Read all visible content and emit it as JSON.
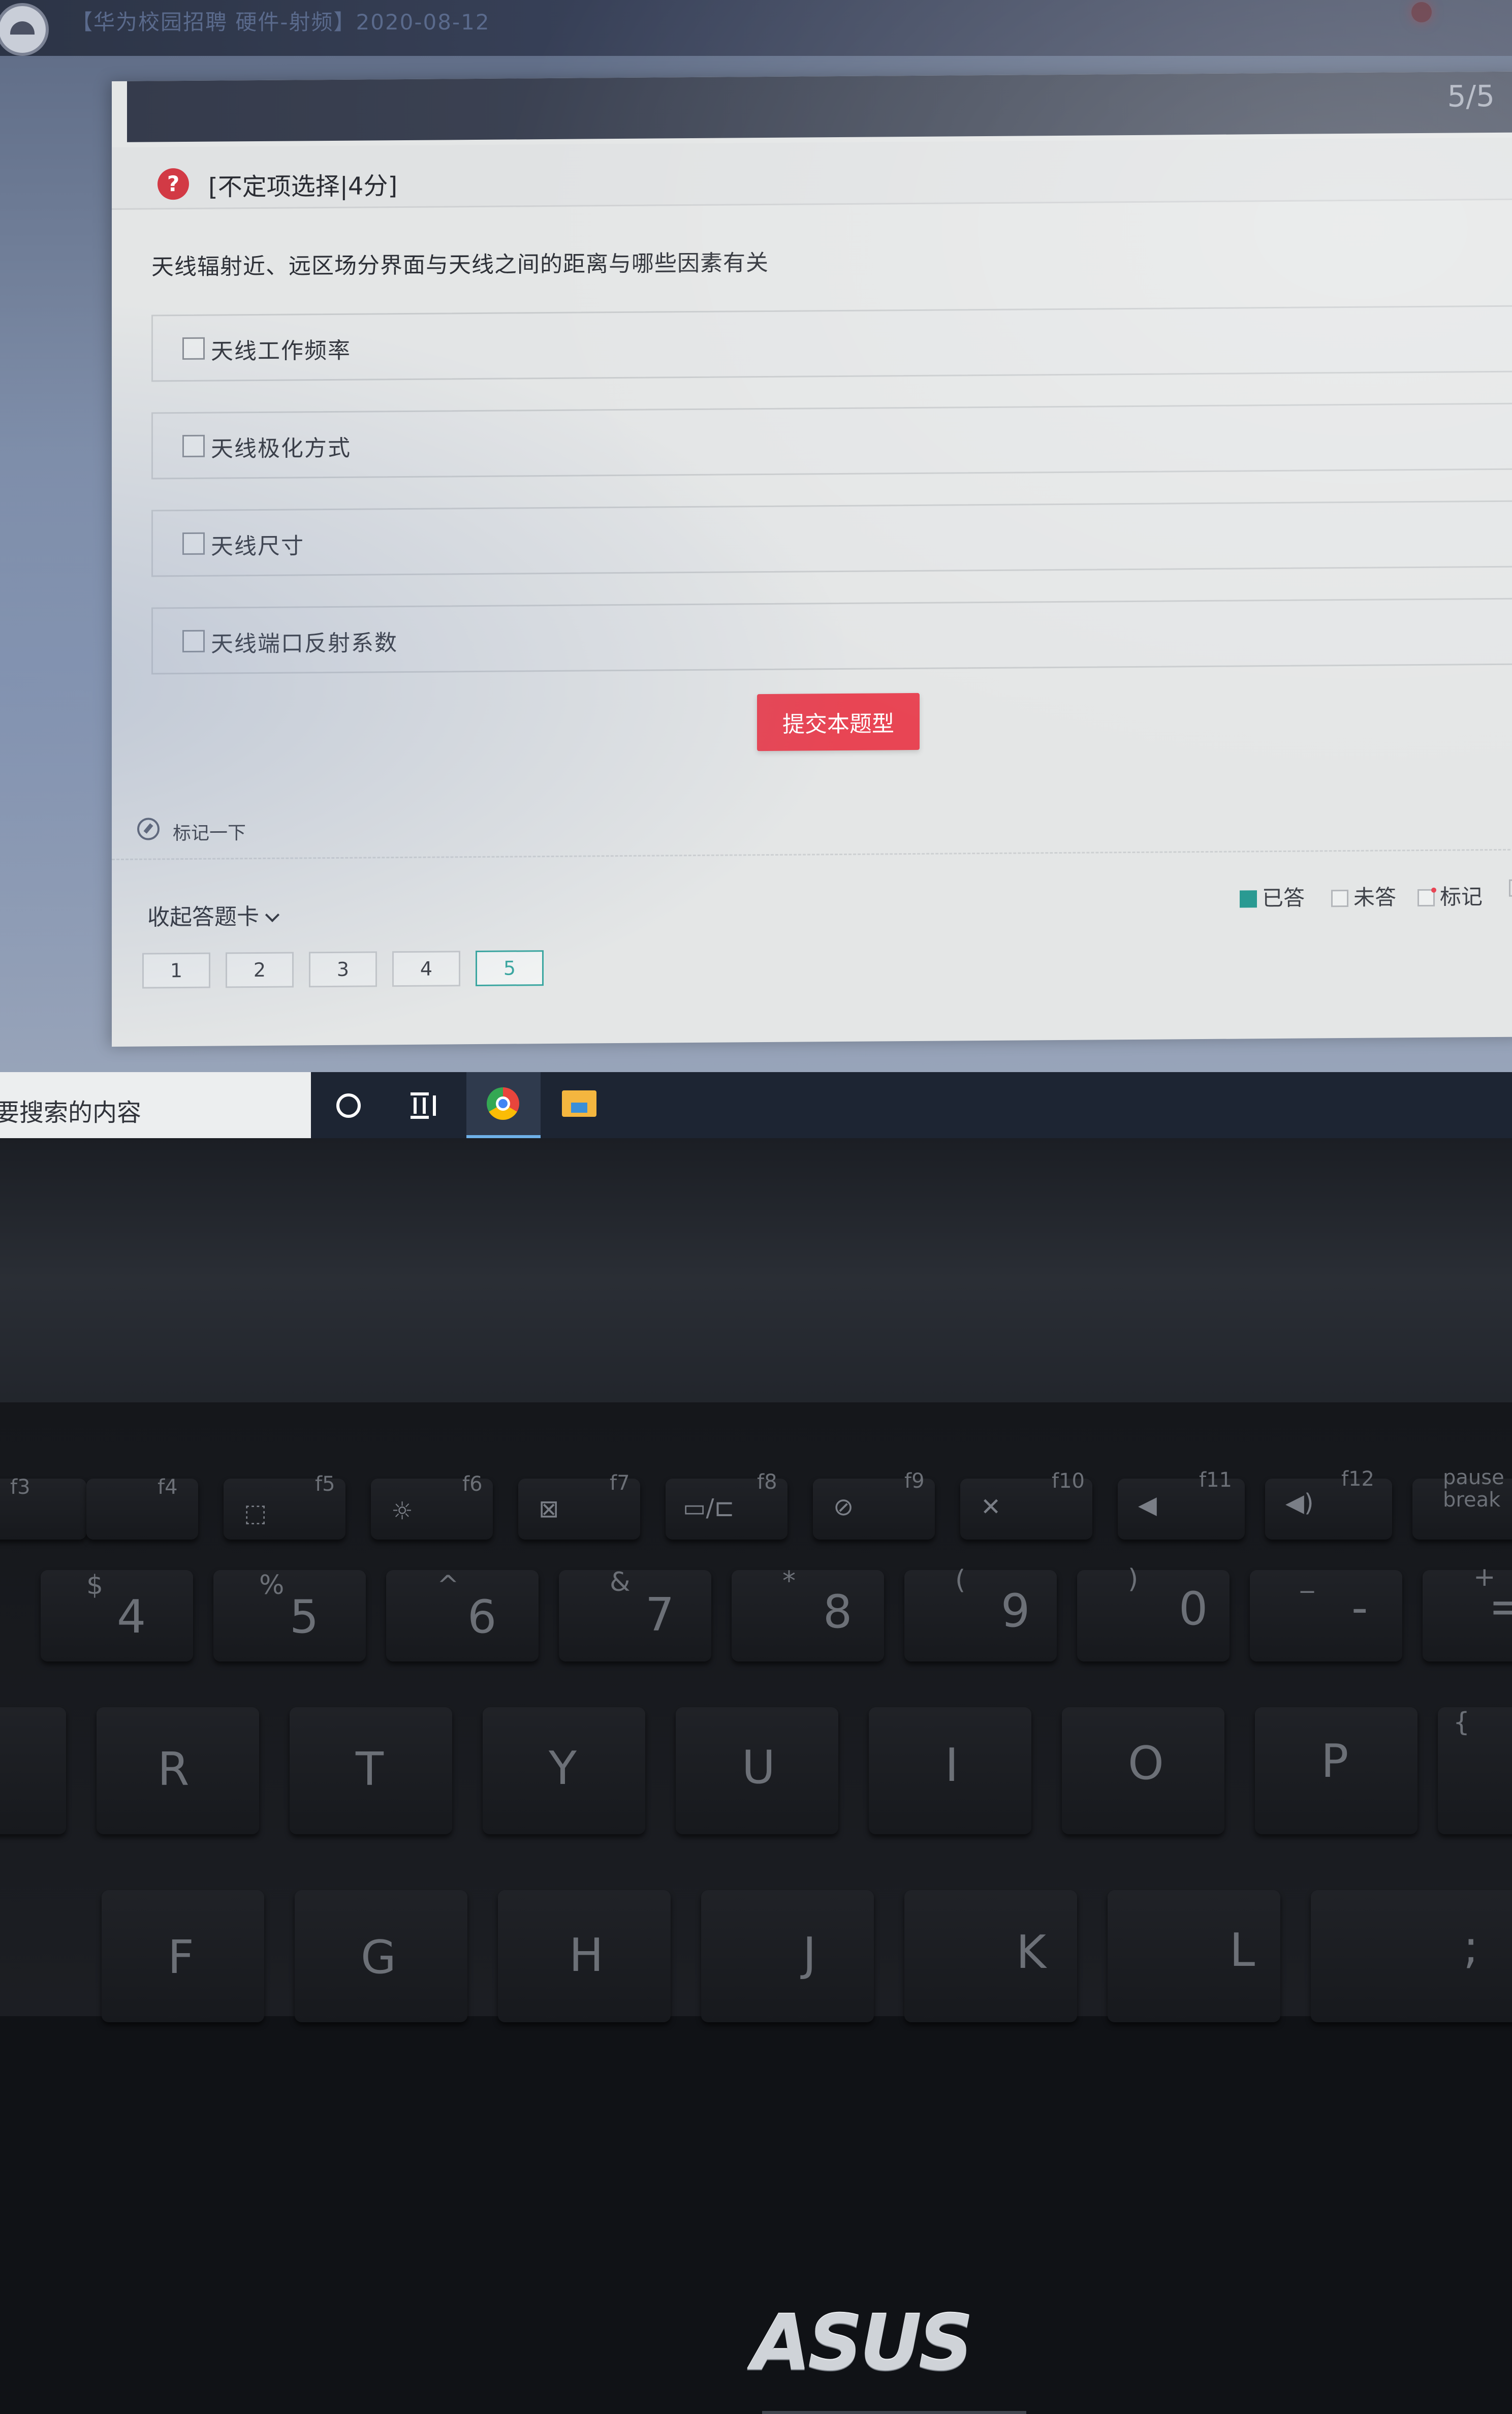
{
  "window": {
    "title": "【华为校园招聘 硬件-射频】2020-08-12"
  },
  "exam": {
    "progress": "5/5",
    "question_type": "[不定项选择|4分]",
    "question_icon": "?",
    "question_text": "天线辐射近、远区场分界面与天线之间的距离与哪些因素有关",
    "options": [
      {
        "label": "天线工作频率",
        "checked": false
      },
      {
        "label": "天线极化方式",
        "checked": false
      },
      {
        "label": "天线尺寸",
        "checked": false
      },
      {
        "label": "天线端口反射系数",
        "checked": false
      }
    ],
    "submit_label": "提交本题型",
    "mark_label": "标记一下",
    "card_toggle_label": "收起答题卡",
    "legend": {
      "answered": "已答",
      "unanswered": "未答",
      "marked": "标记"
    },
    "question_numbers": [
      "1",
      "2",
      "3",
      "4",
      "5"
    ],
    "current_question": "5",
    "colors": {
      "submit": "#e84554",
      "answered": "#2a9a92",
      "active_outline": "#3aa6a0",
      "icon": "#d23a45"
    }
  },
  "taskbar": {
    "search_text": "要搜索的内容",
    "icons": [
      "cortana-icon",
      "task-view-icon",
      "chrome-icon",
      "file-explorer-icon"
    ]
  },
  "laptop": {
    "brand": "ASUS",
    "function_keys": [
      "f3",
      "f4",
      "f5",
      "f6",
      "f7",
      "f8",
      "f9",
      "f10",
      "f11",
      "f12",
      "pause break"
    ],
    "number_row": [
      {
        "main": "4",
        "shift": "$"
      },
      {
        "main": "5",
        "shift": "%"
      },
      {
        "main": "6",
        "shift": "^"
      },
      {
        "main": "7",
        "shift": "&"
      },
      {
        "main": "8",
        "shift": "*"
      },
      {
        "main": "9",
        "shift": "("
      },
      {
        "main": "0",
        "shift": ")"
      },
      {
        "main": "-",
        "shift": "_"
      },
      {
        "main": "=",
        "shift": "+"
      }
    ],
    "letter_row_top": [
      "R",
      "T",
      "Y",
      "U",
      "I",
      "O",
      "P",
      "{"
    ],
    "letter_row_home": [
      "F",
      "G",
      "H",
      "J",
      "K",
      "L",
      ";"
    ]
  }
}
